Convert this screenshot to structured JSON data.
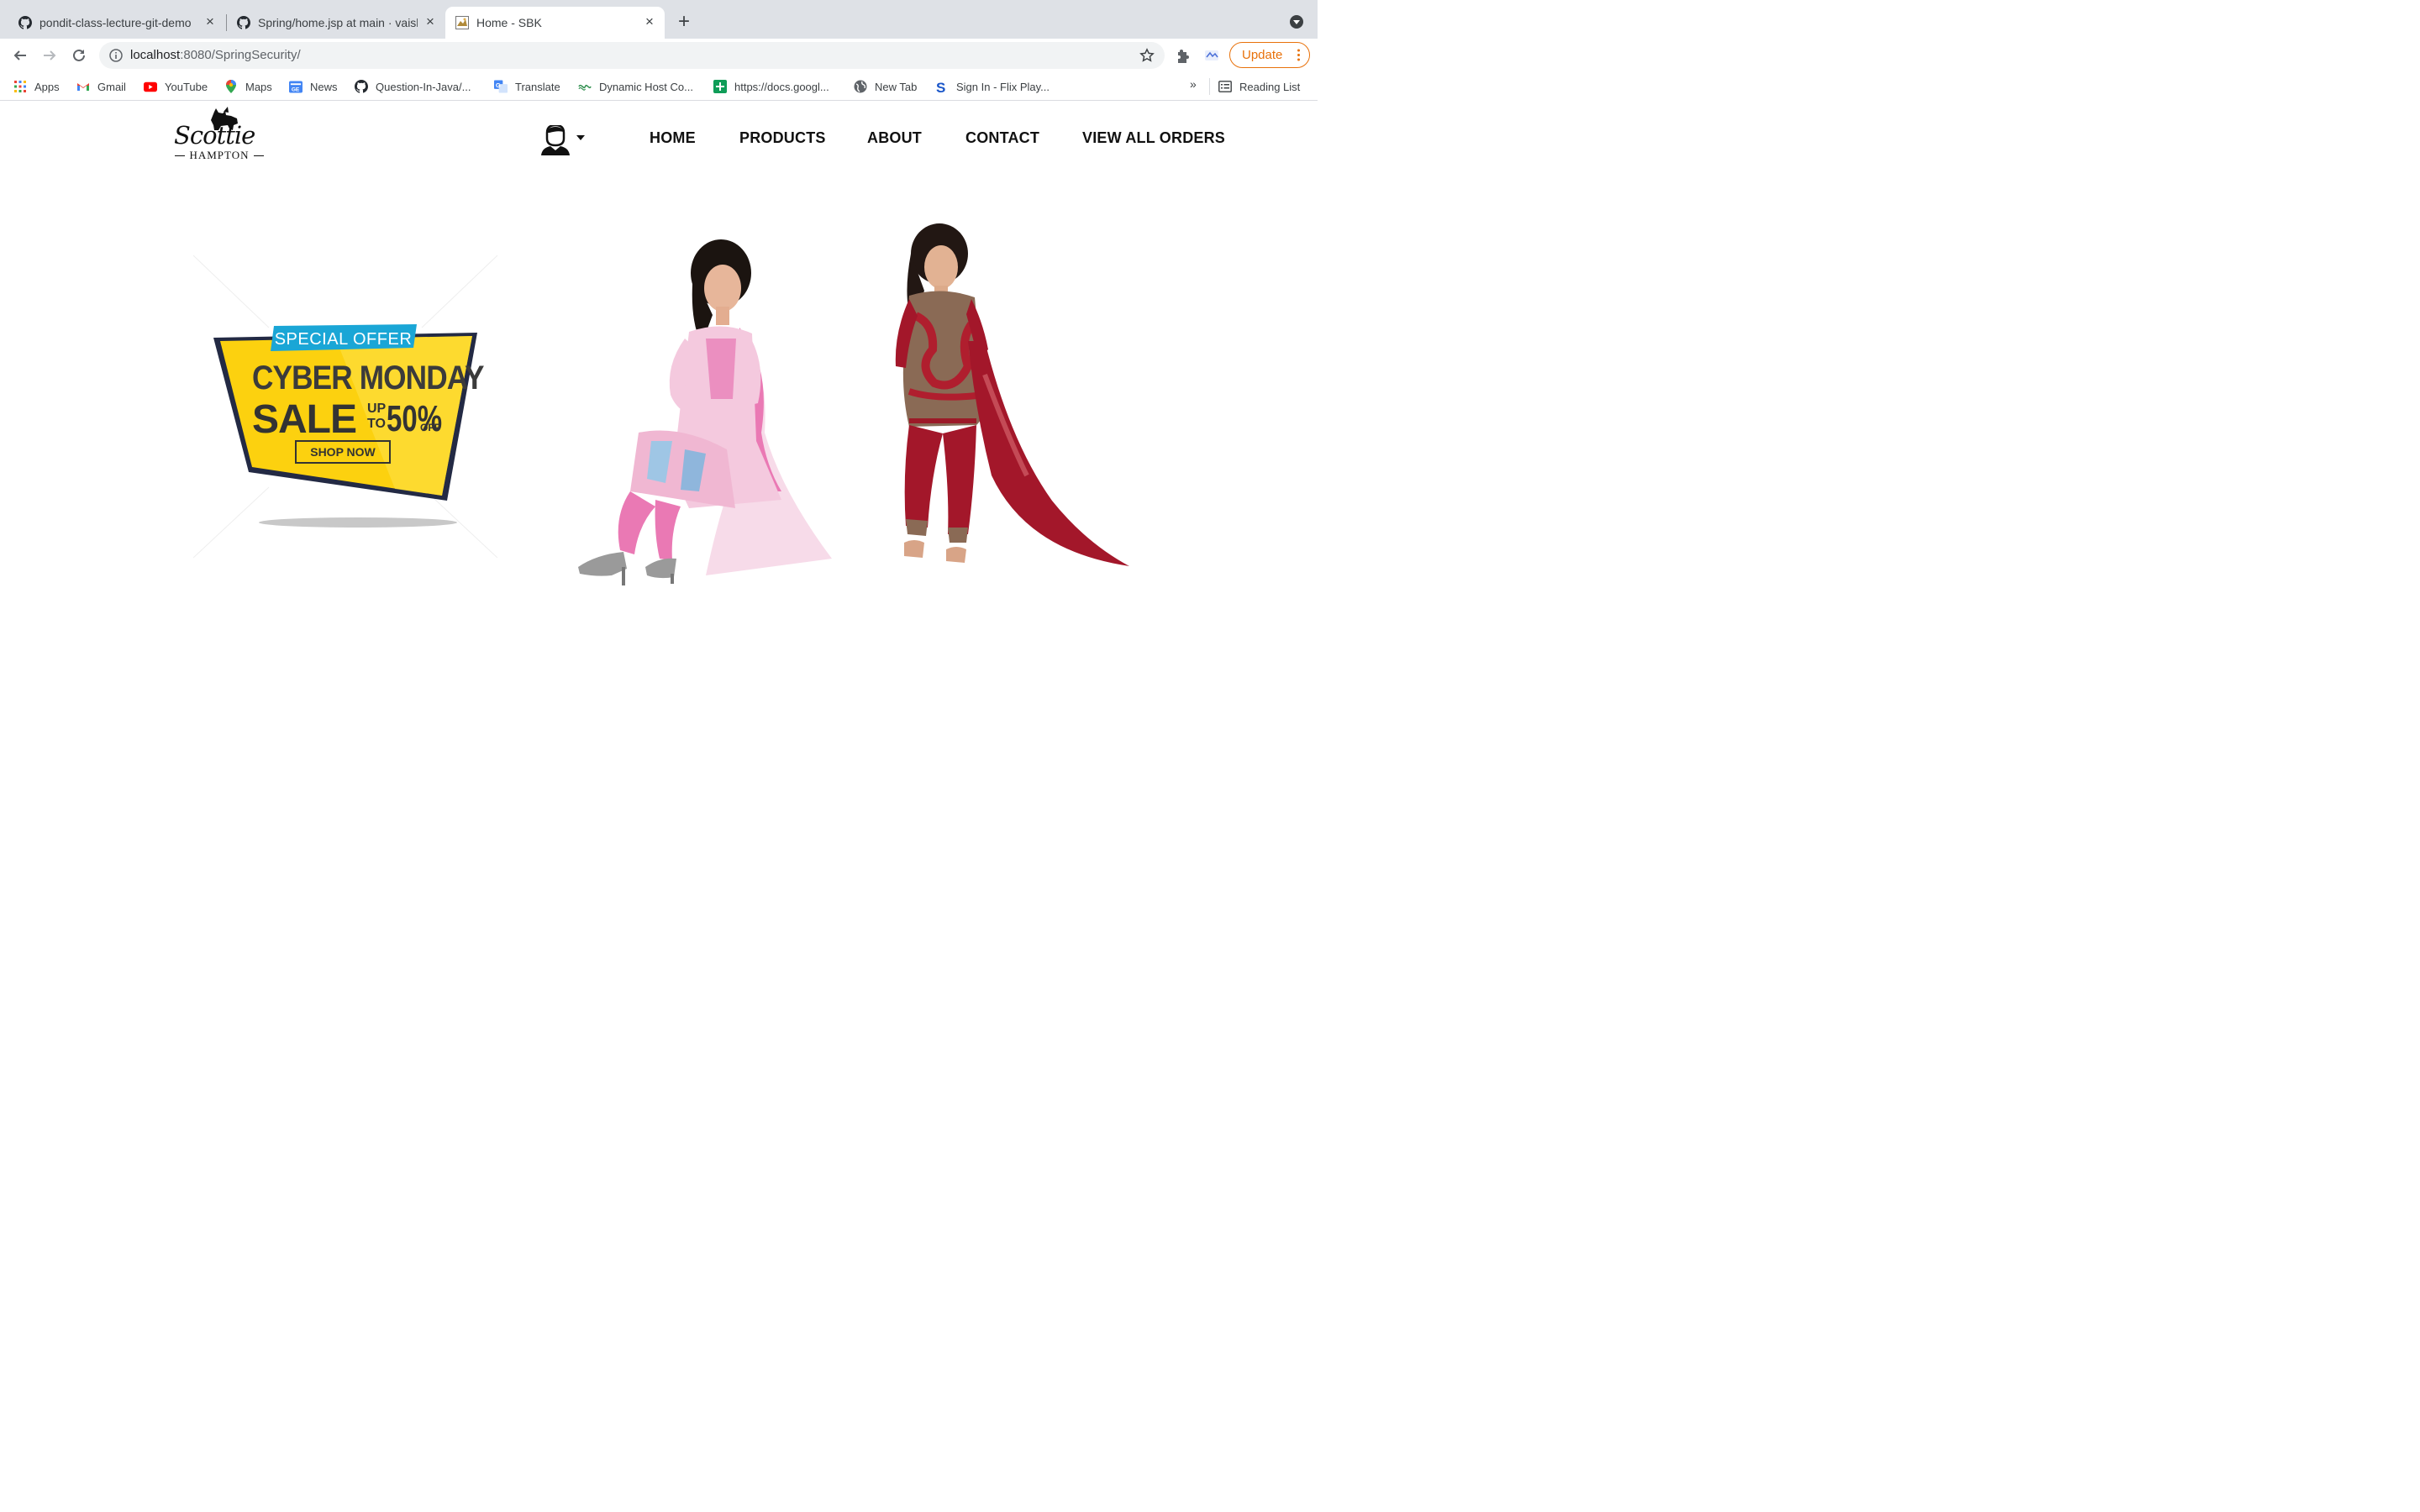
{
  "browser": {
    "tabs": [
      {
        "title": "pondit-class-lecture-git-demo",
        "icon": "github-icon",
        "active": false
      },
      {
        "title": "Spring/home.jsp at main · vaish",
        "icon": "github-icon",
        "active": false
      },
      {
        "title": "Home - SBK",
        "icon": "page-favicon",
        "active": true
      }
    ],
    "url_host": "localhost",
    "url_rest": ":8080/SpringSecurity/",
    "update_label": "Update",
    "bookmarks": [
      {
        "label": "Apps",
        "icon": "apps-grid-icon"
      },
      {
        "label": "Gmail",
        "icon": "gmail-icon"
      },
      {
        "label": "YouTube",
        "icon": "youtube-icon"
      },
      {
        "label": "Maps",
        "icon": "maps-pin-icon"
      },
      {
        "label": "News",
        "icon": "google-news-icon"
      },
      {
        "label": "Question-In-Java/...",
        "icon": "github-icon"
      },
      {
        "label": "Translate",
        "icon": "translate-icon"
      },
      {
        "label": "Dynamic Host Co...",
        "icon": "dynamic-host-icon"
      },
      {
        "label": "https://docs.googl...",
        "icon": "google-sheets-icon"
      },
      {
        "label": "New Tab",
        "icon": "globe-icon"
      },
      {
        "label": "Sign In - Flix Play...",
        "icon": "flix-icon"
      }
    ],
    "bookmarks_overflow": "»",
    "reading_list": "Reading List"
  },
  "site": {
    "logo_word": "Scottie",
    "logo_sub": "HAMPTON",
    "nav": [
      "HOME",
      "PRODUCTS",
      "ABOUT",
      "CONTACT",
      "VIEW ALL ORDERS"
    ],
    "offer": {
      "tag": "SPECIAL OFFER",
      "headline": "CYBER MONDAY",
      "sale": "SALE",
      "up": "UP",
      "to": "TO",
      "percent": "50%",
      "off": "OFF",
      "button": "SHOP NOW"
    }
  },
  "colors": {
    "tab_strip": "#dee1e6",
    "update_orange": "#e8710a",
    "offer_yellow": "#fcd10f",
    "offer_teal": "#1aa6d6",
    "dress_pink": "#e879b0",
    "dress_red": "#a3172a"
  }
}
